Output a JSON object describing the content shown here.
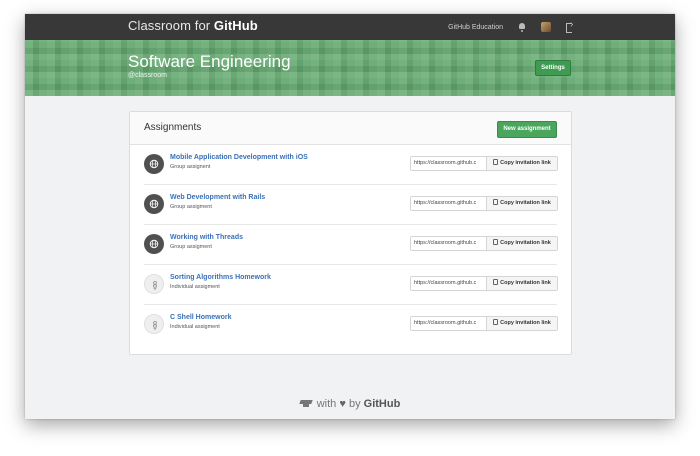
{
  "nav": {
    "brand_light": "Classroom for ",
    "brand_bold": "GitHub",
    "education_link": "GitHub Education",
    "icons": [
      "bell-icon",
      "avatar",
      "sign-out-icon"
    ]
  },
  "banner": {
    "title": "Software Engineering",
    "handle": "@classroom",
    "settings_label": "Settings",
    "color": "#63a86f"
  },
  "panel": {
    "title": "Assignments",
    "new_label": "New assignment"
  },
  "assignments": [
    {
      "title": "Mobile Application Development with iOS",
      "type": "Group assignent",
      "kind": "group",
      "link": "https://classroom.github.c",
      "copy_label": "Copy invitation link"
    },
    {
      "title": "Web Development with Rails",
      "type": "Group assigment",
      "kind": "group",
      "link": "https://classroom.github.c",
      "copy_label": "Copy invitation link"
    },
    {
      "title": "Working with Threads",
      "type": "Group assigment",
      "kind": "group",
      "link": "https://classroom.github.c",
      "copy_label": "Copy invitation link"
    },
    {
      "title": "Sorting Algorithms Homework",
      "type": "Individual assigment",
      "kind": "individual",
      "link": "https://classroom.github.c",
      "copy_label": "Copy invitation link"
    },
    {
      "title": "C Shell Homework",
      "type": "Individual assigment",
      "kind": "individual",
      "link": "https://classroom.github.c",
      "copy_label": "Copy invitation link"
    }
  ],
  "footer": {
    "with": "with",
    "by": "by",
    "brand": "GitHub"
  },
  "colors": {
    "nav_bg": "#383838",
    "accent_green": "#4aa55d",
    "link_blue": "#3a70b8"
  }
}
